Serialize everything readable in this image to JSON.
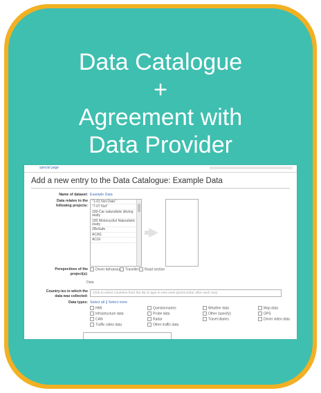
{
  "heading": {
    "line1": "Data Catalogue",
    "line2": "+",
    "line3": "Agreement with",
    "line4": "Data Provider"
  },
  "screenshot": {
    "tab": "special page",
    "title": "Add a new entry to the Data Catalogue: Example Data",
    "name_label": "Name of dataset:",
    "name_value": "Example Data",
    "projects_label_1": "Data relates to the",
    "projects_label_2": "following projects:",
    "projects": [
      "\"1-01 Not Data\"",
      "\"7-07 Not\"",
      "100-Car naturalistic driving study",
      "100 Motorcyclist Naturalistic study",
      "2BeSafe",
      "ACAS",
      "ACGI"
    ],
    "perspectives_label_1": "Perspectives of the",
    "perspectives_label_2": "project(s):",
    "perspectives": [
      "Driver behaviour",
      "Traveller",
      "Road section"
    ],
    "data_heading": "Data",
    "country_label_1": "Country-ies in which the",
    "country_label_2": "data was collected:",
    "country_placeholder": "Click to select countries from the list or type in new ones (press Enter after each one)",
    "datatypes_label": "Data types:",
    "select_links": "Select all || Select none",
    "datatypes": [
      "HMI",
      "Questionnaires",
      "Weather data",
      "Map data",
      "Infrastructure data",
      "Probe data",
      "Other (specify)",
      "GPS",
      "CAN",
      "Radar",
      "Travel diaries",
      "Driver video data",
      "Traffic video data",
      "Other traffic data"
    ]
  }
}
